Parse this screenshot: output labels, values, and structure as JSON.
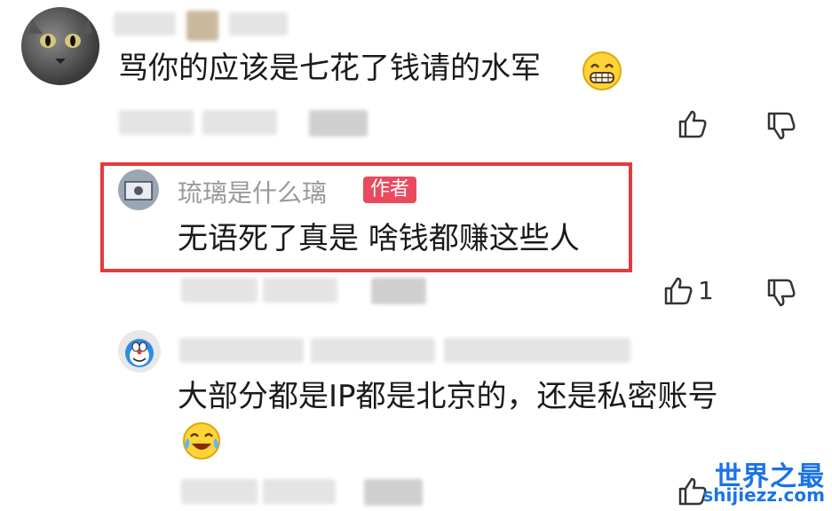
{
  "comments": [
    {
      "text": "骂你的应该是七花了钱请的水军",
      "emoji": "grin-emoji",
      "likes": ""
    },
    {
      "username": "琉璃是什么璃",
      "badge": "作者",
      "text": "无语死了真是  啥钱都赚这些人",
      "likes": "1"
    },
    {
      "text": "大部分都是IP都是北京的，还是私密账号",
      "emoji": "tears-of-joy-emoji",
      "likes": ""
    }
  ],
  "watermark": {
    "title": "世界之最",
    "url": "shijiezz.com"
  },
  "colors": {
    "highlight": "#e33b3b",
    "badge": "#e94a5d",
    "watermark": "#1a73e8"
  }
}
